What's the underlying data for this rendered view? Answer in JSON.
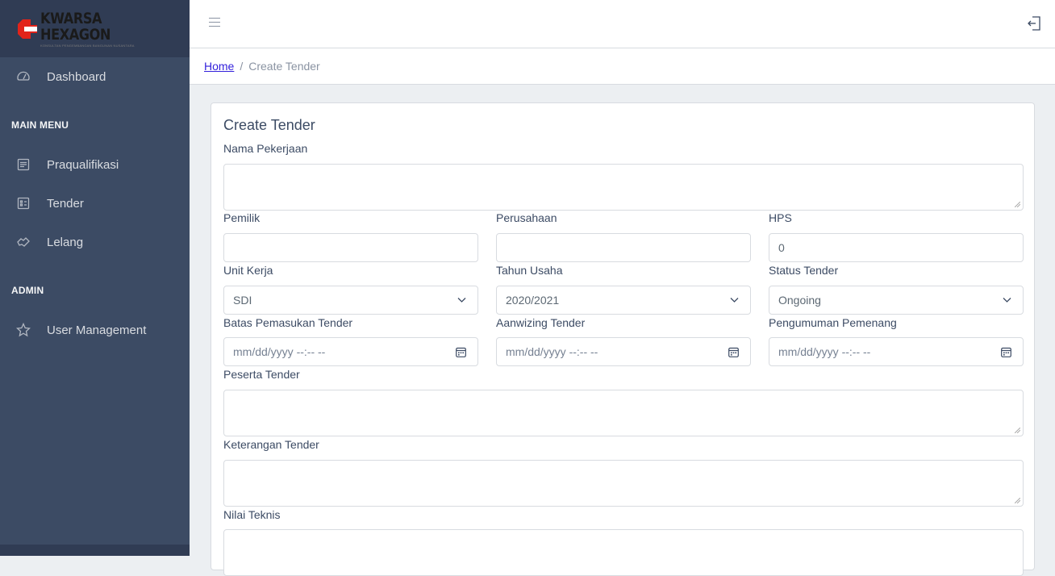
{
  "brand": {
    "name": "KWARSA HEXAGON",
    "tagline": "KONSULTAN PENGEMBANGAN BANGUNAN NUSANTARA"
  },
  "sidebar": {
    "dashboard": "Dashboard",
    "main_menu_title": "MAIN MENU",
    "main_menu": [
      "Praqualifikasi",
      "Tender",
      "Lelang"
    ],
    "admin_title": "ADMIN",
    "admin": [
      "User Management"
    ]
  },
  "breadcrumb": {
    "home": "Home",
    "separator": "/",
    "current": "Create Tender"
  },
  "form": {
    "title": "Create Tender",
    "nama_pekerjaan": {
      "label": "Nama Pekerjaan",
      "value": ""
    },
    "pemilik": {
      "label": "Pemilik",
      "value": ""
    },
    "perusahaan": {
      "label": "Perusahaan",
      "value": ""
    },
    "hps": {
      "label": "HPS",
      "value": "0"
    },
    "unit_kerja": {
      "label": "Unit Kerja",
      "value": "SDI"
    },
    "tahun_usaha": {
      "label": "Tahun Usaha",
      "value": "2020/2021"
    },
    "status_tender": {
      "label": "Status Tender",
      "value": "Ongoing"
    },
    "batas_pemasukan": {
      "label": "Batas Pemasukan Tender",
      "placeholder": "mm/dd/yyyy --:-- --"
    },
    "aanwizing": {
      "label": "Aanwizing Tender",
      "placeholder": "mm/dd/yyyy --:-- --"
    },
    "pengumuman": {
      "label": "Pengumuman Pemenang",
      "placeholder": "mm/dd/yyyy --:-- --"
    },
    "peserta_tender": {
      "label": "Peserta Tender",
      "value": ""
    },
    "keterangan_tender": {
      "label": "Keterangan Tender",
      "value": ""
    },
    "nilai_teknis": {
      "label": "Nilai Teknis",
      "value": ""
    }
  },
  "icons": {
    "nav": [
      "speedometer-icon",
      "list-icon",
      "grid-icon",
      "hand-icon",
      "star-icon"
    ],
    "header": [
      "menu-icon",
      "logout-icon"
    ],
    "fields": [
      "chevron-down-icon",
      "calendar-icon"
    ]
  },
  "colors": {
    "sidebar": "#3c4b64",
    "sidebar_brand": "#303c54",
    "link": "#321fdb",
    "brand_red": "#e2231a",
    "background": "#eceff2"
  }
}
